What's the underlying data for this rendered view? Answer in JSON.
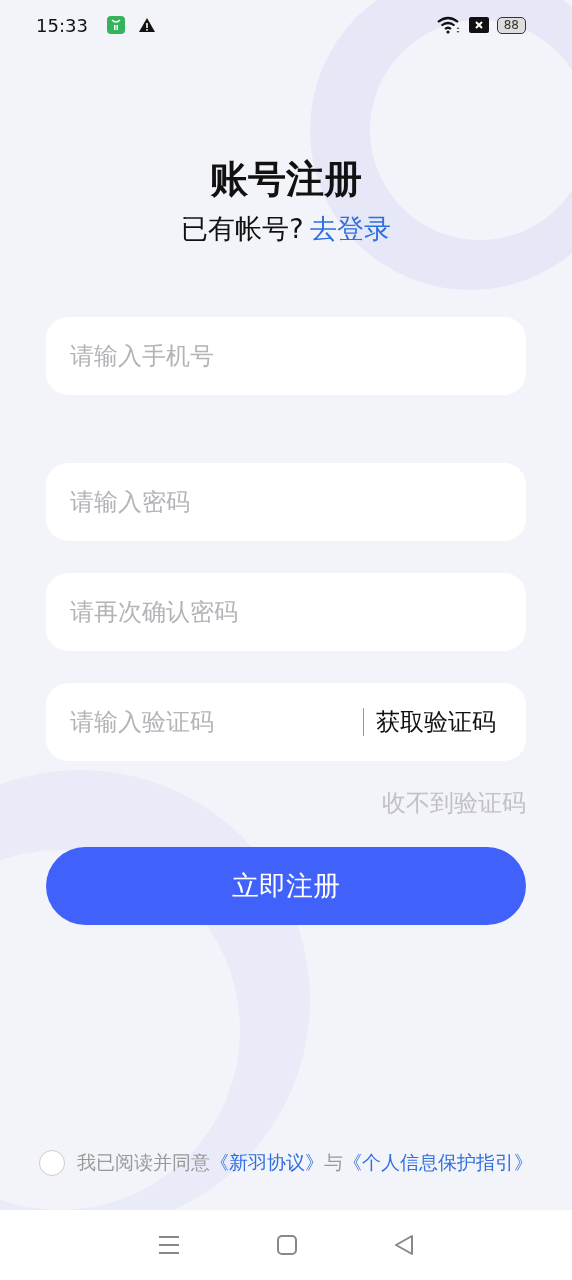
{
  "status_bar": {
    "time": "15:33",
    "battery": "88"
  },
  "title": "账号注册",
  "subtitle": {
    "text": "已有帐号?",
    "link": "去登录"
  },
  "fields": [
    {
      "kind": "plain",
      "placeholder": "请输入手机号"
    },
    {
      "kind": "plain",
      "placeholder": "请输入密码"
    },
    {
      "kind": "plain",
      "placeholder": "请再次确认密码"
    },
    {
      "kind": "code",
      "placeholder": "请输入验证码",
      "action": "获取验证码"
    }
  ],
  "no_code_link": "收不到验证码",
  "submit_button": "立即注册",
  "agreement": {
    "checked": false,
    "text": "我已阅读并同意",
    "link_1": "《新羽协议》",
    "connector": "与",
    "link_2": "《个人信息保护指引》"
  }
}
